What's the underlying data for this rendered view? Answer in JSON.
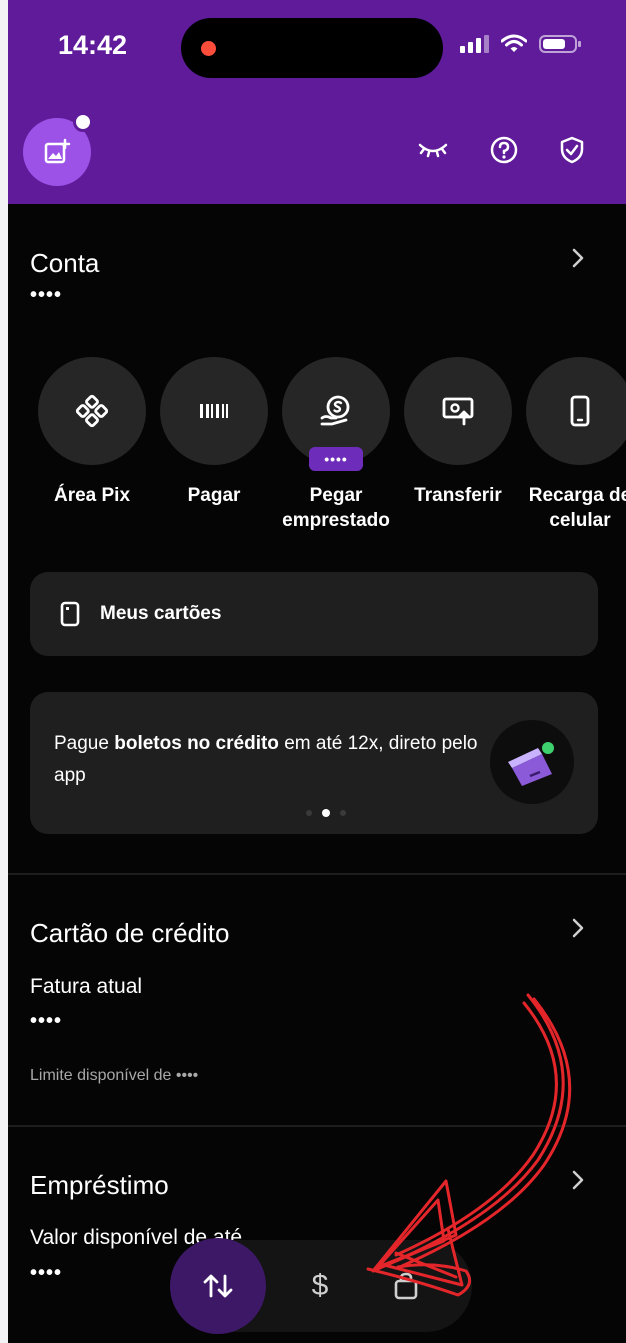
{
  "colors": {
    "brand": "#5f1b9a",
    "accent": "#9c52e6",
    "annotation": "#e4262b"
  },
  "status_bar": {
    "time": "14:42"
  },
  "header": {
    "icons": [
      "add-photo-icon",
      "eye-closed-icon",
      "help-icon",
      "shield-check-icon"
    ]
  },
  "account": {
    "title": "Conta",
    "balance_masked": "••••"
  },
  "shortcuts": [
    {
      "label": "Área Pix",
      "icon": "pix-icon"
    },
    {
      "label": "Pagar",
      "icon": "barcode-icon"
    },
    {
      "label": "Pegar\nemprestado",
      "icon": "loan-icon",
      "badge": "••••"
    },
    {
      "label": "Transferir",
      "icon": "transfer-icon"
    },
    {
      "label": "Recarga de\ncelular",
      "icon": "phone-icon"
    }
  ],
  "cards_button": {
    "label": "Meus cartões"
  },
  "promo": {
    "text_before": "Pague ",
    "text_bold": "boletos no crédito",
    "text_after": " em até 12x, direto pelo app",
    "carousel_active_index": 1,
    "carousel_count": 3
  },
  "credit_card": {
    "title": "Cartão de crédito",
    "invoice_label": "Fatura atual",
    "invoice_masked": "••••",
    "limit_text": "Limite disponível de ••••"
  },
  "loan": {
    "title": "Empréstimo",
    "available_label": "Valor disponível de até",
    "available_masked": "••••"
  },
  "tabbar": {
    "tabs": [
      {
        "name": "tab-transactions",
        "icon": "arrows-up-down-icon",
        "active": true
      },
      {
        "name": "tab-money",
        "icon": "dollar-icon",
        "label": "$"
      },
      {
        "name": "tab-shopping",
        "icon": "bag-icon"
      }
    ]
  }
}
